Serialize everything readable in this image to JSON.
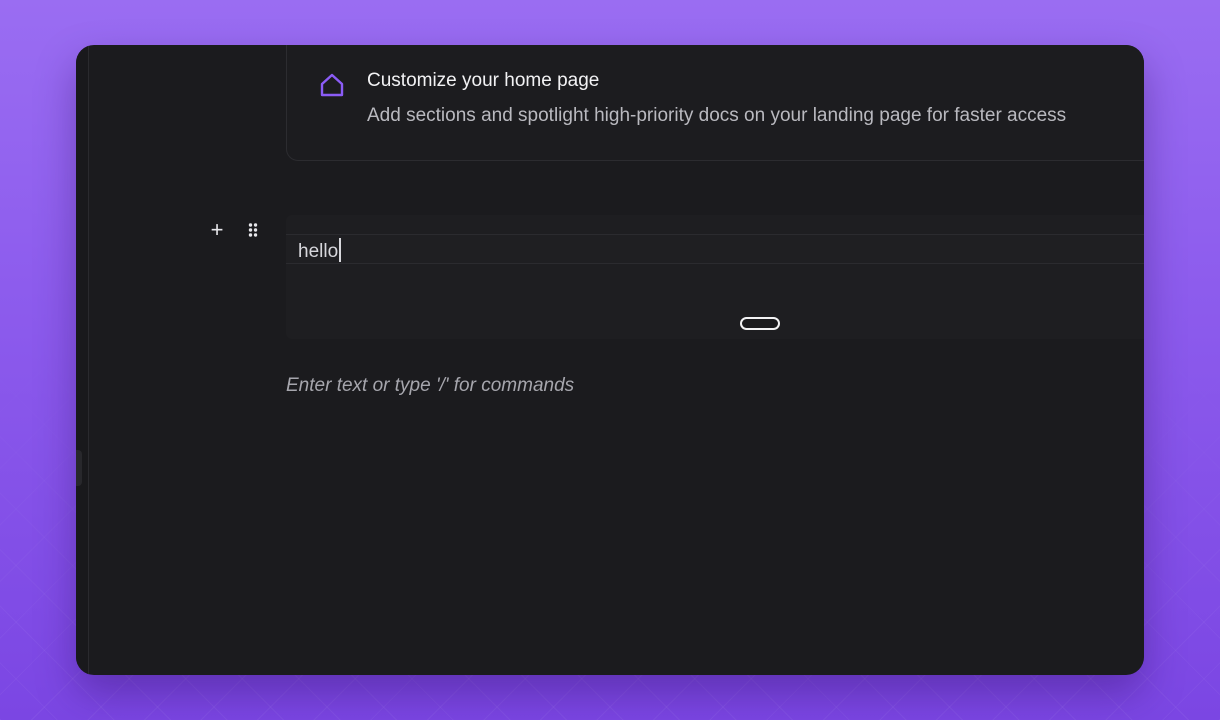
{
  "callout": {
    "icon": "home-icon",
    "title": "Customize your home page",
    "description": "Add sections and spotlight high-priority docs on your landing page for faster access"
  },
  "block_tools": {
    "add_icon": "plus-icon",
    "add_symbol": "+",
    "drag_icon": "drag-handle-icon"
  },
  "editor": {
    "text_block_value": "hello",
    "placeholder": "Enter text or type '/' for commands"
  },
  "colors": {
    "accent": "#8b5cf6",
    "background_top": "#9a6df2",
    "background_bottom": "#7b46e3",
    "panel": "#1b1b1e"
  }
}
